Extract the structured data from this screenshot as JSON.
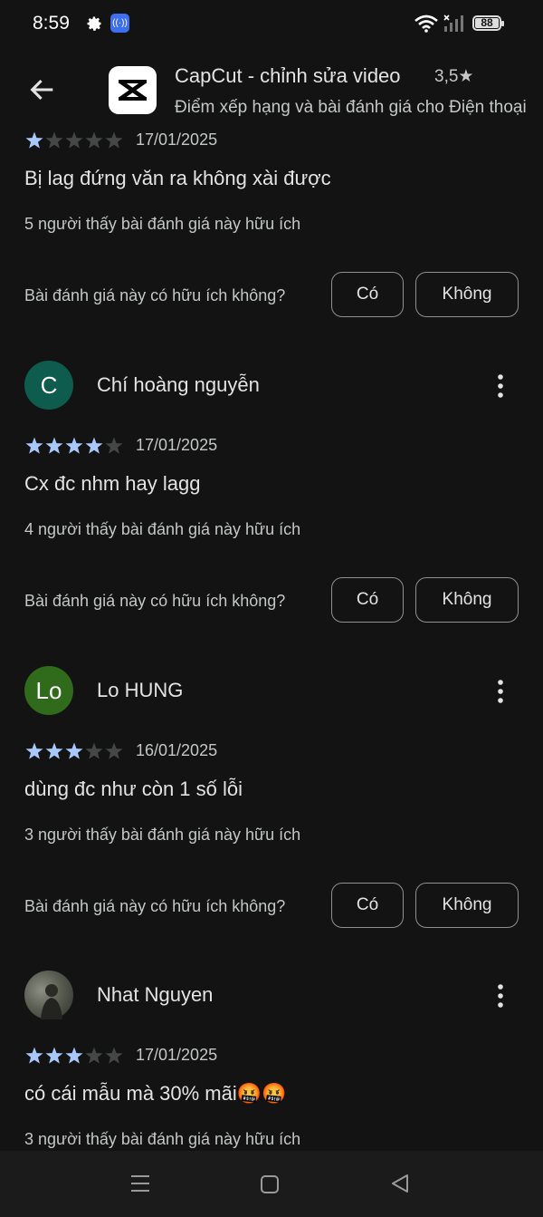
{
  "status_bar": {
    "time": "8:59",
    "battery": "88",
    "icons": [
      "gear-icon",
      "cast-icon",
      "wifi-icon",
      "signal-icon",
      "battery-icon"
    ]
  },
  "header": {
    "app_name": "CapCut - chỉnh sửa video",
    "rating": "3,5★",
    "subtitle": "Điểm xếp hạng và bài đánh giá cho Điện thoại"
  },
  "colors": {
    "background": "#131314",
    "star_filled": "#a8c7fa",
    "star_empty": "#444746",
    "avatar_c": "#0d5c4d",
    "avatar_lo": "#2f6b1a"
  },
  "helpful_question": "Bài đánh giá này có hữu ích không?",
  "btn_yes": "Có",
  "btn_no": "Không",
  "reviews": [
    {
      "name": "",
      "rating": 1,
      "date": "17/01/2025",
      "text": "Bị lag đứng văn ra không xài được",
      "helpful": "5 người thấy bài đánh giá này hữu ích"
    },
    {
      "name": "Chí hoàng nguyễn",
      "avatar_letter": "C",
      "rating": 4,
      "date": "17/01/2025",
      "text": "Cx đc nhm hay lagg",
      "helpful": "4 người thấy bài đánh giá này hữu ích"
    },
    {
      "name": "Lo HUNG",
      "avatar_letter": "Lo",
      "rating": 3,
      "date": "16/01/2025",
      "text": "dùng đc như còn 1 số lỗi",
      "helpful": "3 người thấy bài đánh giá này hữu ích"
    },
    {
      "name": "Nhat Nguyen",
      "rating": 3,
      "date": "17/01/2025",
      "text": "có cái mẫu mà 30% mãi🤬🤬",
      "helpful": "3 người thấy bài đánh giá này hữu ích"
    }
  ]
}
